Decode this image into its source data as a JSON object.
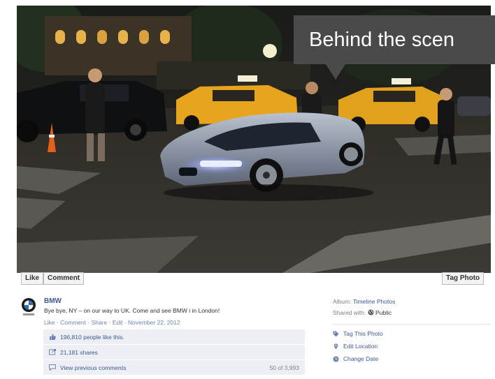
{
  "overlay": {
    "callout_text": "Behind the scen"
  },
  "photo_actions": {
    "like": "Like",
    "comment": "Comment",
    "tag": "Tag Photo"
  },
  "post": {
    "author": "BMW",
    "message": "Bye bye, NY – on our way to UK. Come and see BMW i in London!",
    "actions": {
      "like": "Like",
      "comment": "Comment",
      "share": "Share",
      "edit": "Edit",
      "date": "November 22, 2012",
      "sep": " · "
    }
  },
  "ufi": {
    "likes": "196,810 people like this.",
    "shares": "21,181 shares",
    "view_comments": "View previous comments",
    "comment_count": "50 of 3,993"
  },
  "side": {
    "album_label": "Album:",
    "album_value": "Timeline Photos",
    "shared_label": "Shared with:",
    "shared_value": "Public",
    "actions": [
      "Tag This Photo",
      "Edit Location",
      "Change Date"
    ]
  },
  "colors": {
    "link": "#3b5998",
    "ufi_bg": "#edeff4",
    "callout_bg": "#4a4a4a"
  }
}
